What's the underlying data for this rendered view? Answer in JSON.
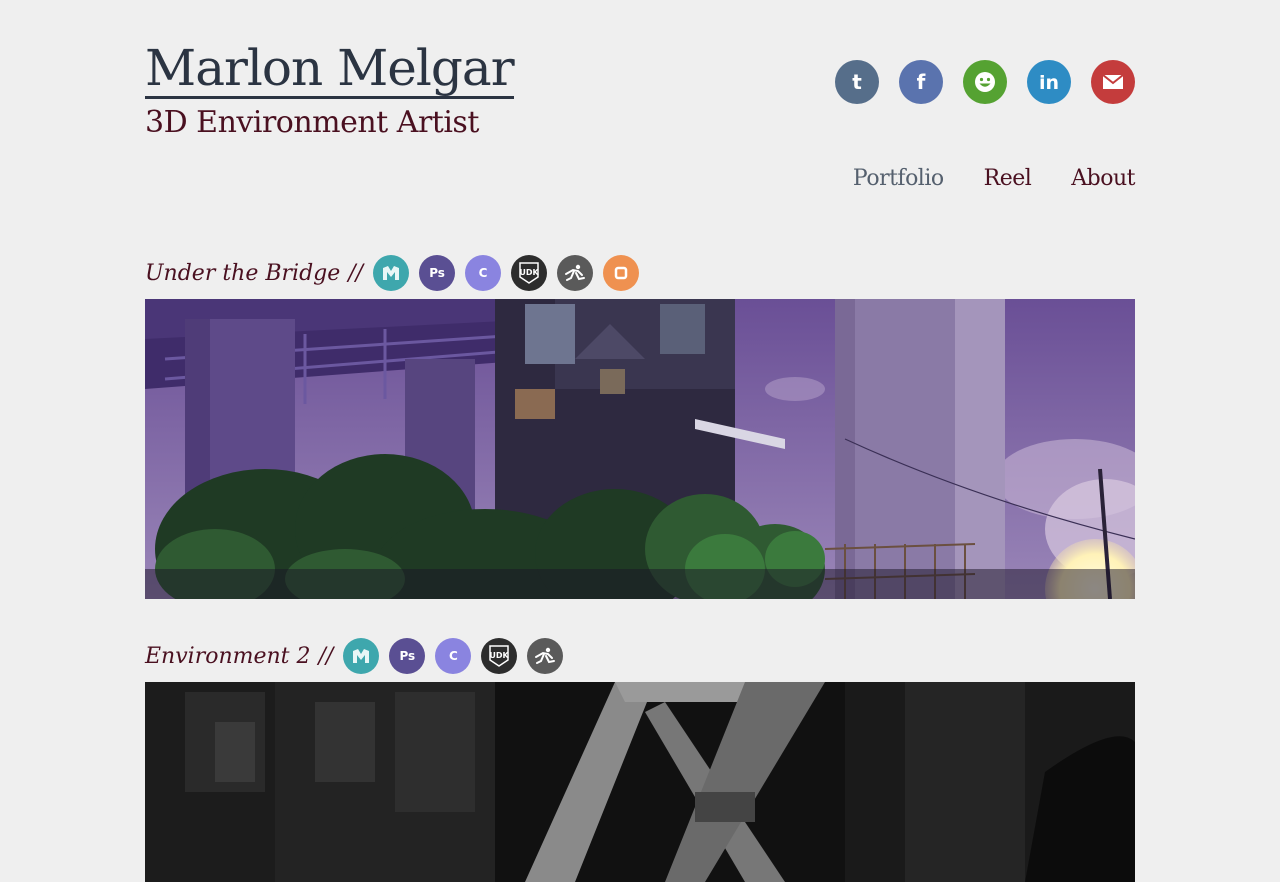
{
  "header": {
    "name": "Marlon Melgar",
    "role": "3D Environment Artist"
  },
  "social": [
    {
      "icon": "tumblr-icon",
      "glyph": "t",
      "color": "#566e8a"
    },
    {
      "icon": "facebook-icon",
      "glyph": "f",
      "color": "#5a73ae"
    },
    {
      "icon": "smiley-icon",
      "glyph": "☻",
      "color": "#55a232"
    },
    {
      "icon": "linkedin-icon",
      "glyph": "in",
      "color": "#2e8cc4"
    },
    {
      "icon": "mail-icon",
      "glyph": "✉",
      "color": "#c43c3c"
    }
  ],
  "nav": {
    "portfolio": "Portfolio",
    "reel": "Reel",
    "about": "About"
  },
  "projects": [
    {
      "title": "Under the Bridge",
      "separator": "//",
      "tools": [
        {
          "icon": "maya-icon",
          "label": "",
          "color": "#3ea7ad"
        },
        {
          "icon": "photoshop-icon",
          "label": "Ps",
          "color": "#5a4f93"
        },
        {
          "icon": "crazybump-icon",
          "label": "C",
          "color": "#8a84e0"
        },
        {
          "icon": "udk-icon",
          "label": "UDK",
          "color": "#2d2d2d"
        },
        {
          "icon": "zbrush-icon",
          "label": "",
          "color": "#5a5a5a"
        },
        {
          "icon": "substance-icon",
          "label": "",
          "color": "#ef9150"
        }
      ]
    },
    {
      "title": "Environment 2",
      "separator": "//",
      "tools": [
        {
          "icon": "maya-icon",
          "label": "",
          "color": "#3ea7ad"
        },
        {
          "icon": "photoshop-icon",
          "label": "Ps",
          "color": "#5a4f93"
        },
        {
          "icon": "crazybump-icon",
          "label": "C",
          "color": "#8a84e0"
        },
        {
          "icon": "udk-icon",
          "label": "UDK",
          "color": "#2d2d2d"
        },
        {
          "icon": "zbrush-icon",
          "label": "",
          "color": "#5a5a5a"
        }
      ]
    }
  ]
}
